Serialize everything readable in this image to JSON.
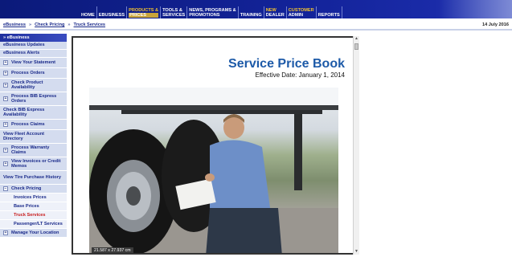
{
  "nav": {
    "items": [
      {
        "label": "HOME"
      },
      {
        "label": "EBUSINESS"
      },
      {
        "label_top": "PRODUCTS &",
        "label_bottom": "PRICES"
      },
      {
        "label_top": "TOOLS &",
        "label_bottom": "SERVICES"
      },
      {
        "label_top": "NEWS, PROGRAMS &",
        "label_bottom": "PROMOTIONS"
      },
      {
        "label": "TRAINING"
      },
      {
        "label_top": "NEW",
        "label_bottom": "DEALER"
      },
      {
        "label_top": "CUSTOMER",
        "label_bottom": "ADMIN"
      },
      {
        "label": "REPORTS"
      }
    ]
  },
  "breadcrumb": {
    "items": [
      "eBusiness",
      "Check Pricing",
      "Truck Services"
    ],
    "separator": "»"
  },
  "date": "14 July 2016",
  "sidebar": {
    "header": "» eBusiness",
    "items": [
      {
        "label": "eBusiness Updates",
        "icon": "",
        "type": "plain"
      },
      {
        "label": "eBusiness Alerts",
        "icon": "",
        "type": "plain"
      },
      {
        "label": "View Your Statement",
        "icon": "plus-box-icon",
        "type": "expand"
      },
      {
        "label": "Process Orders",
        "icon": "plus-box-icon",
        "type": "expand"
      },
      {
        "label": "Check Product Availability",
        "icon": "plus-box-icon",
        "type": "expand"
      },
      {
        "label": "Process BIB Express Orders",
        "icon": "plus-box-icon",
        "type": "expand"
      },
      {
        "label": "Check BIB Express Availability",
        "icon": "",
        "type": "plain"
      },
      {
        "label": "Process Claims",
        "icon": "plus-box-icon",
        "type": "expand"
      },
      {
        "label": "View Fleet Account Directory",
        "icon": "",
        "type": "plain"
      },
      {
        "label": "Process Warranty Claims",
        "icon": "plus-box-icon",
        "type": "expand"
      },
      {
        "label": "View Invoices or Credit Memos",
        "icon": "plus-box-icon",
        "type": "expand"
      },
      {
        "label": "View Tire Purchase History",
        "icon": "",
        "type": "plain"
      },
      {
        "label": "Check Pricing",
        "icon": "minus-box-icon",
        "type": "expand"
      },
      {
        "label": "Invoices Prices",
        "icon": "",
        "type": "sub"
      },
      {
        "label": "Base Prices",
        "icon": "",
        "type": "sub"
      },
      {
        "label": "Truck Services",
        "icon": "",
        "type": "sub-active"
      },
      {
        "label": "Passenger/LT Services",
        "icon": "",
        "type": "sub"
      },
      {
        "label": "Manage Your Location",
        "icon": "plus-box-icon",
        "type": "expand"
      }
    ]
  },
  "document": {
    "title": "Service Price Book",
    "subtitle": "Effective Date: January 1, 2014",
    "size_tag": "21.587 x 27.937 cm"
  },
  "colors": {
    "nav_bg": "#13239a",
    "nav_highlight": "#c8a43a",
    "sidebar_bg": "#d4dcef",
    "active_link": "#c81b1b",
    "title_blue": "#1d5aa8"
  }
}
